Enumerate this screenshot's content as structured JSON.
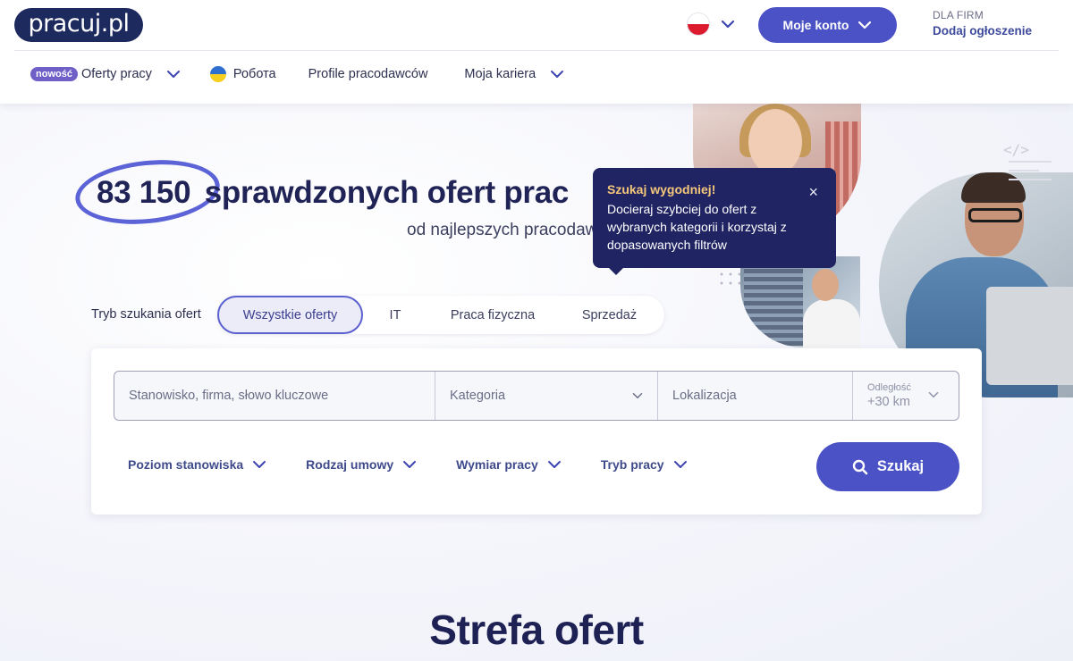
{
  "header": {
    "logo_text": "pracuj.pl",
    "account_label": "Moje konto",
    "for_firms_label": "DLA FIRM",
    "post_ad_label": "Dodaj ogłoszenie"
  },
  "nav": {
    "new_badge": "nowość",
    "items": [
      {
        "label": "Oferty pracy",
        "icon": "chevron-down-icon"
      },
      {
        "label": "Робота",
        "icon": "ukraine-flag-icon"
      },
      {
        "label": "Profile pracodawców"
      },
      {
        "label": "Moja kariera",
        "icon": "chevron-down-icon"
      }
    ]
  },
  "hero": {
    "count": "83 150",
    "headline_rest": "sprawdzonych ofert prac",
    "subline": "od najlepszych pracodaw"
  },
  "tooltip": {
    "title": "Szukaj wygodniej!",
    "body": "Docieraj szybciej do ofert z wybranych kategorii i korzystaj z dopasowanych filtrów",
    "close": "×"
  },
  "decor": {
    "code_icon": "</>"
  },
  "search_mode": {
    "label": "Tryb szukania ofert",
    "tabs": [
      {
        "label": "Wszystkie oferty",
        "active": true
      },
      {
        "label": "IT"
      },
      {
        "label": "Praca fizyczna"
      },
      {
        "label": "Sprzedaż"
      }
    ]
  },
  "search": {
    "keyword_placeholder": "Stanowisko, firma, słowo kluczowe",
    "category_placeholder": "Kategoria",
    "location_placeholder": "Lokalizacja",
    "distance_label": "Odległość",
    "distance_value": "+30 km",
    "filters": [
      "Poziom stanowiska",
      "Rodzaj umowy",
      "Wymiar pracy",
      "Tryb pracy"
    ],
    "button_label": "Szukaj"
  },
  "section_title": "Strefa ofert",
  "colors": {
    "primary": "#4b52c6",
    "navy": "#1f2356",
    "tooltip_bg": "#202463",
    "tooltip_title": "#f5c77a",
    "badge": "#6e60c7"
  }
}
